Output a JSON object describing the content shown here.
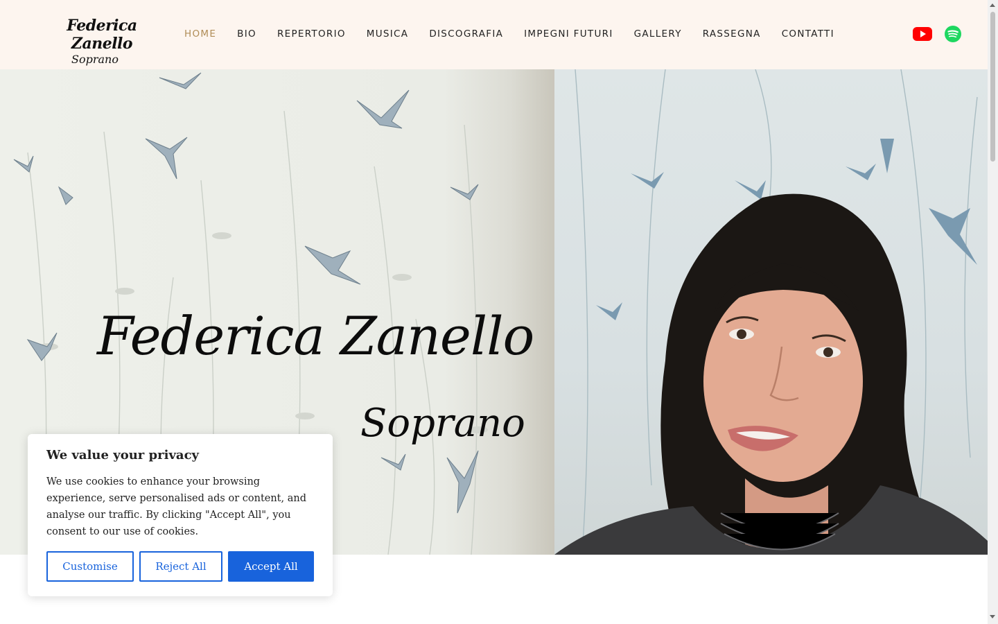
{
  "logo": {
    "name": "Federica Zanello",
    "subtitle": "Soprano"
  },
  "nav": {
    "items": [
      {
        "label": "HOME",
        "active": true
      },
      {
        "label": "BIO"
      },
      {
        "label": "REPERTORIO"
      },
      {
        "label": "MUSICA"
      },
      {
        "label": "DISCOGRAFIA"
      },
      {
        "label": "IMPEGNI FUTURI"
      },
      {
        "label": "GALLERY"
      },
      {
        "label": "RASSEGNA"
      },
      {
        "label": "CONTATTI"
      }
    ]
  },
  "social": {
    "youtube_icon": "youtube-icon",
    "spotify_icon": "spotify-icon"
  },
  "hero": {
    "title": "Federica Zanello",
    "subtitle": "Soprano"
  },
  "cookie": {
    "title": "We value your privacy",
    "text": "We use cookies to enhance your browsing experience, serve personalised ads or content, and analyse our traffic. By clicking \"Accept All\", you consent to our use of cookies.",
    "customise": "Customise",
    "reject": "Reject All",
    "accept": "Accept All"
  },
  "colors": {
    "header_bg": "#fdf5ef",
    "nav_active": "#b08d57",
    "accent_blue": "#1863dc",
    "youtube_red": "#ff0000",
    "spotify_green": "#1ed760"
  }
}
